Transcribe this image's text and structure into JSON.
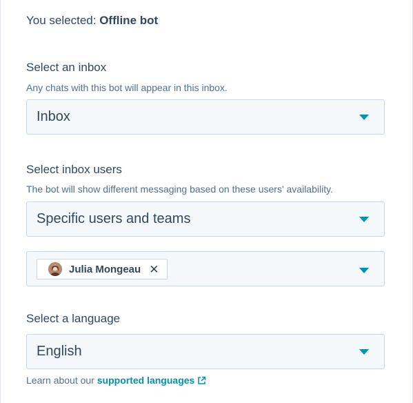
{
  "selection": {
    "prefix": "You selected:",
    "value": "Offline bot"
  },
  "inbox": {
    "title": "Select an inbox",
    "help": "Any chats with this bot will appear in this inbox.",
    "selected": "Inbox"
  },
  "inbox_users": {
    "title": "Select inbox users",
    "help": "The bot will show different messaging based on these users' availability.",
    "selected": "Specific users and teams",
    "chips": [
      {
        "name": "Julia Mongeau",
        "remove": "✕"
      }
    ]
  },
  "language": {
    "title": "Select a language",
    "selected": "English",
    "note_prefix": "Learn about our",
    "link_label": "supported languages"
  },
  "colors": {
    "text": "#33475b",
    "help_text": "#516f90",
    "accent": "#0091ae",
    "field_bg": "#f5f8fa",
    "field_border": "#cbd6e2"
  },
  "icons": {
    "caret": "caret-down-icon",
    "remove": "close-icon",
    "external": "external-link-icon"
  }
}
